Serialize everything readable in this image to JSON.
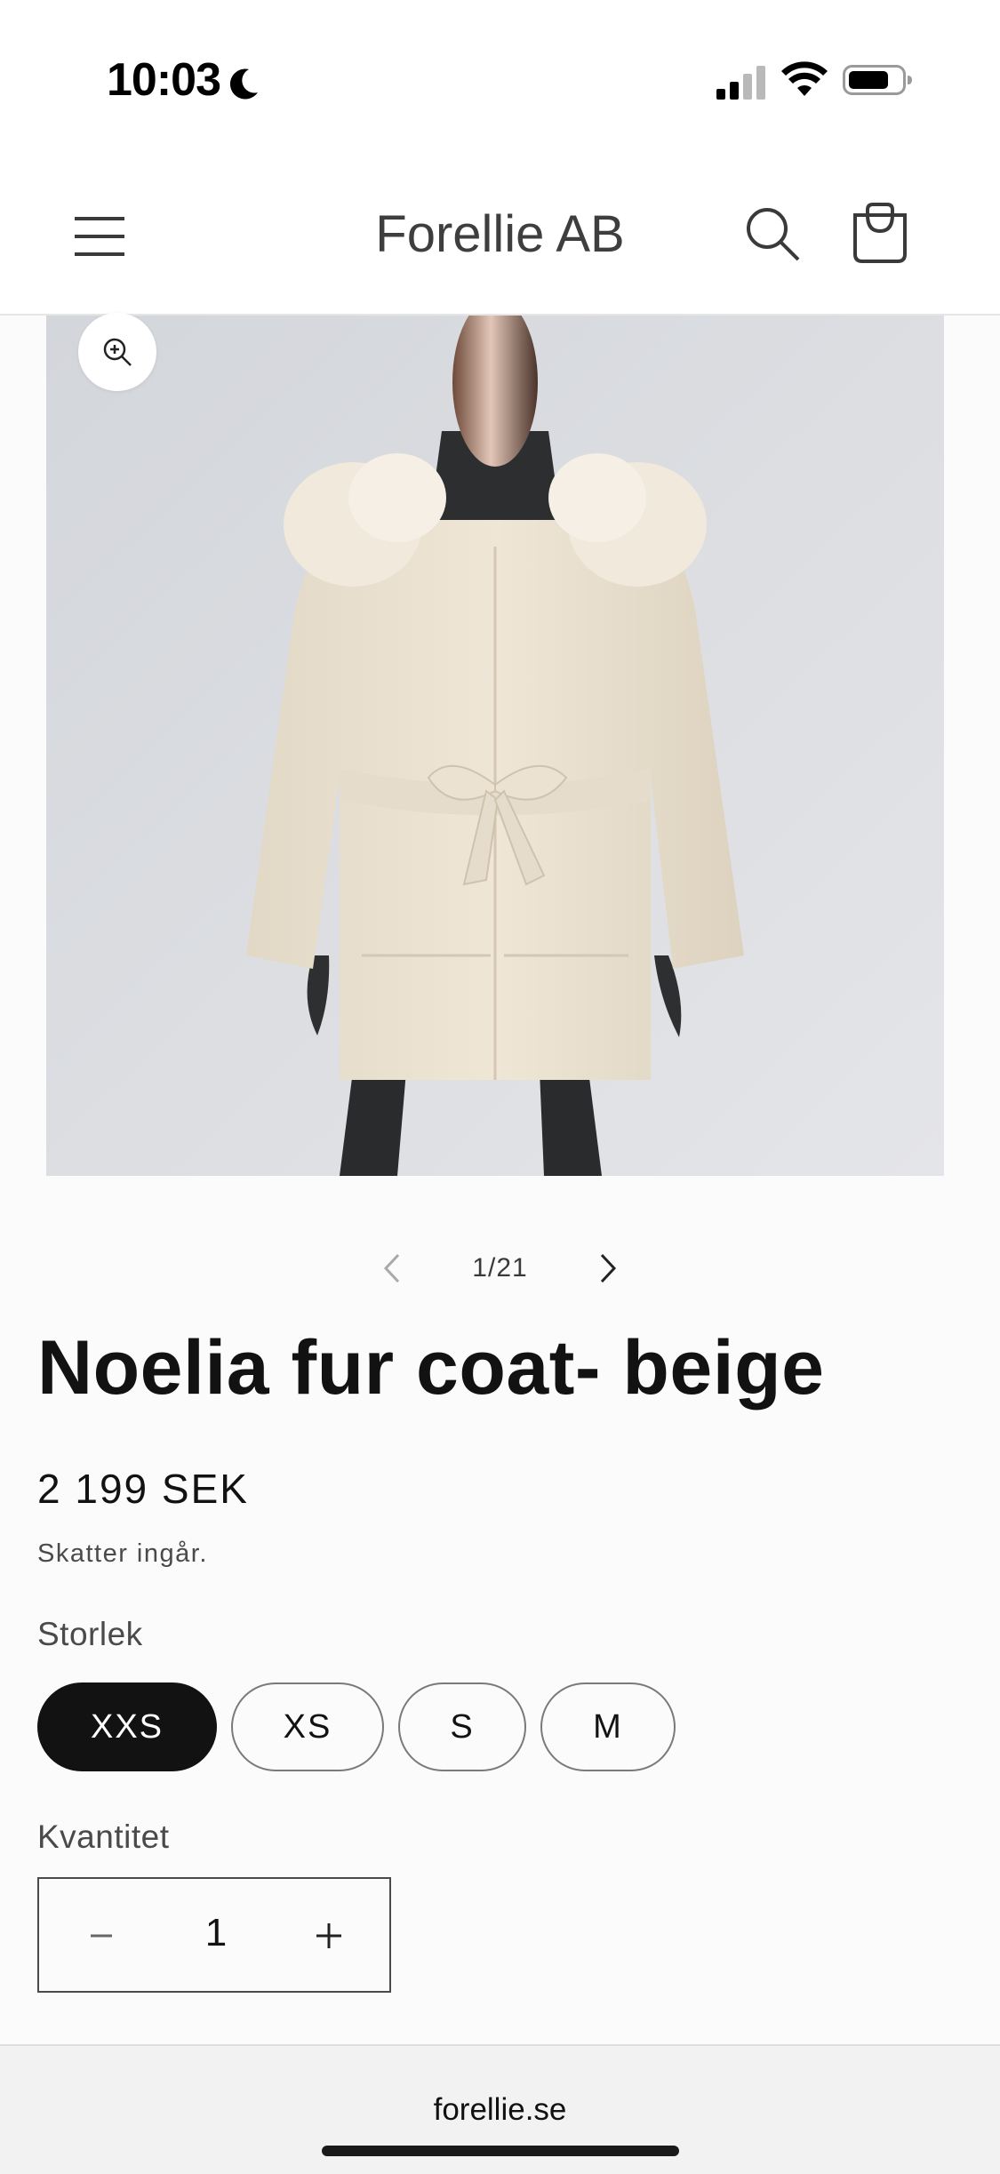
{
  "status_bar": {
    "time": "10:03",
    "icons": [
      "moon-icon",
      "cellular-signal-icon",
      "wifi-icon",
      "battery-icon"
    ]
  },
  "header": {
    "brand": "Forellie AB",
    "icons": [
      "menu-icon",
      "search-icon",
      "cart-icon"
    ]
  },
  "gallery": {
    "counter": "1/21",
    "icons": [
      "zoom-in-icon",
      "chevron-left-icon",
      "chevron-right-icon"
    ]
  },
  "product": {
    "title": "Noelia fur coat- beige",
    "price": "2 199 SEK",
    "tax_note": "Skatter ingår."
  },
  "size": {
    "label": "Storlek",
    "options": [
      "XXS",
      "XS",
      "S",
      "M"
    ],
    "selected": "XXS"
  },
  "quantity": {
    "label": "Kvantitet",
    "value": "1",
    "icons": [
      "minus-icon",
      "plus-icon"
    ]
  },
  "browser": {
    "url": "forellie.se"
  },
  "colors": {
    "accent": "#121212",
    "background": "#fbfbfb",
    "image_background": "#d9dbdf",
    "coat": "#ece3d3"
  }
}
